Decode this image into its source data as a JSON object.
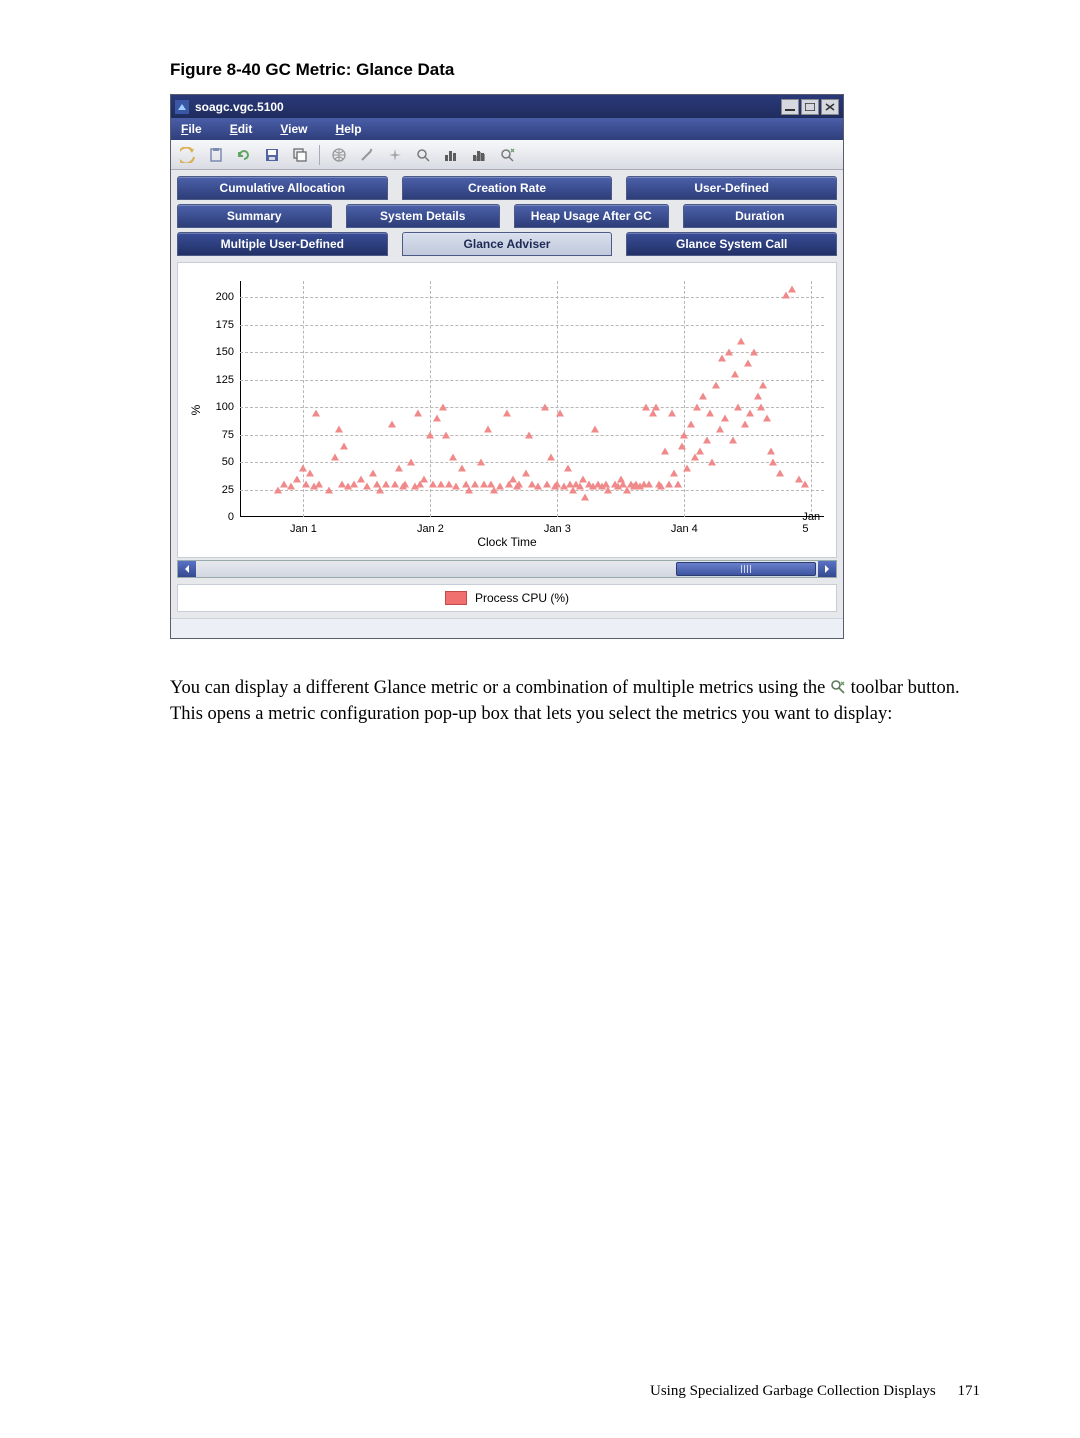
{
  "figure_caption": "Figure 8-40 GC Metric: Glance Data",
  "window": {
    "title": "soagc.vgc.5100",
    "menu": {
      "file": "File",
      "edit": "Edit",
      "view": "View",
      "help": "Help"
    },
    "toolbar_icons": [
      "back-arrow-icon",
      "clipboard-icon",
      "refresh-icon",
      "save-icon",
      "windows-icon",
      "globe-icon",
      "wand-icon",
      "sparkle-icon",
      "zoom-icon",
      "bars-icon",
      "bars-shadow-icon",
      "zoom-reset-icon"
    ],
    "win_btns": {
      "min": "minimize-icon",
      "max": "maximize-icon",
      "close": "close-icon"
    }
  },
  "tabs": {
    "row1": [
      "Cumulative Allocation",
      "Creation Rate",
      "User-Defined"
    ],
    "row2": [
      "Summary",
      "System Details",
      "Heap Usage After GC",
      "Duration"
    ],
    "row3": [
      "Multiple User-Defined",
      "Glance Adviser",
      "Glance System Call"
    ],
    "selected": "Glance Adviser"
  },
  "legend": {
    "series": "Process CPU (%)"
  },
  "body_text": {
    "p1a": "You can display a different Glance metric or a combination of multiple metrics using the ",
    "p1b": " toolbar button. This opens a metric configuration pop-up box that lets you select the metrics you want to display:"
  },
  "footer": {
    "section": "Using Specialized Garbage Collection Displays",
    "page": "171"
  },
  "chart_data": {
    "type": "scatter",
    "title": "",
    "xlabel": "Clock Time",
    "ylabel": "%",
    "ylim": [
      0,
      215
    ],
    "yticks": [
      0,
      25,
      50,
      75,
      100,
      125,
      150,
      175,
      200
    ],
    "xticks": [
      "Jan 1",
      "Jan 2",
      "Jan 3",
      "Jan 4",
      "Jan 5"
    ],
    "xrange": [
      0.5,
      5.1
    ],
    "series": [
      {
        "name": "Process CPU (%)",
        "color": "#f08a8a",
        "points": [
          [
            0.8,
            25
          ],
          [
            0.85,
            30
          ],
          [
            0.9,
            28
          ],
          [
            0.95,
            35
          ],
          [
            1.0,
            45
          ],
          [
            1.02,
            30
          ],
          [
            1.05,
            40
          ],
          [
            1.08,
            28
          ],
          [
            1.1,
            95
          ],
          [
            1.12,
            30
          ],
          [
            1.2,
            25
          ],
          [
            1.25,
            55
          ],
          [
            1.28,
            80
          ],
          [
            1.3,
            30
          ],
          [
            1.32,
            65
          ],
          [
            1.35,
            28
          ],
          [
            1.4,
            30
          ],
          [
            1.45,
            35
          ],
          [
            1.5,
            28
          ],
          [
            1.55,
            40
          ],
          [
            1.58,
            30
          ],
          [
            1.6,
            25
          ],
          [
            1.65,
            30
          ],
          [
            1.7,
            85
          ],
          [
            1.72,
            30
          ],
          [
            1.75,
            45
          ],
          [
            1.78,
            28
          ],
          [
            1.8,
            30
          ],
          [
            1.85,
            50
          ],
          [
            1.88,
            28
          ],
          [
            1.9,
            95
          ],
          [
            1.92,
            30
          ],
          [
            1.95,
            35
          ],
          [
            2.0,
            75
          ],
          [
            2.02,
            30
          ],
          [
            2.05,
            90
          ],
          [
            2.08,
            30
          ],
          [
            2.1,
            100
          ],
          [
            2.12,
            75
          ],
          [
            2.15,
            30
          ],
          [
            2.18,
            55
          ],
          [
            2.2,
            28
          ],
          [
            2.25,
            45
          ],
          [
            2.28,
            30
          ],
          [
            2.3,
            25
          ],
          [
            2.35,
            30
          ],
          [
            2.4,
            50
          ],
          [
            2.42,
            30
          ],
          [
            2.45,
            80
          ],
          [
            2.48,
            30
          ],
          [
            2.5,
            25
          ],
          [
            2.55,
            28
          ],
          [
            2.6,
            95
          ],
          [
            2.62,
            30
          ],
          [
            2.65,
            35
          ],
          [
            2.68,
            28
          ],
          [
            2.7,
            30
          ],
          [
            2.75,
            40
          ],
          [
            2.78,
            75
          ],
          [
            2.8,
            30
          ],
          [
            2.85,
            28
          ],
          [
            2.9,
            100
          ],
          [
            2.92,
            30
          ],
          [
            2.95,
            55
          ],
          [
            2.98,
            28
          ],
          [
            3.0,
            30
          ],
          [
            3.02,
            95
          ],
          [
            3.05,
            28
          ],
          [
            3.08,
            45
          ],
          [
            3.1,
            30
          ],
          [
            3.12,
            25
          ],
          [
            3.15,
            30
          ],
          [
            3.18,
            28
          ],
          [
            3.2,
            35
          ],
          [
            3.22,
            18
          ],
          [
            3.25,
            30
          ],
          [
            3.28,
            28
          ],
          [
            3.3,
            80
          ],
          [
            3.32,
            30
          ],
          [
            3.35,
            28
          ],
          [
            3.38,
            30
          ],
          [
            3.4,
            25
          ],
          [
            3.45,
            30
          ],
          [
            3.48,
            28
          ],
          [
            3.5,
            35
          ],
          [
            3.52,
            30
          ],
          [
            3.55,
            25
          ],
          [
            3.58,
            30
          ],
          [
            3.6,
            28
          ],
          [
            3.62,
            30
          ],
          [
            3.65,
            28
          ],
          [
            3.68,
            30
          ],
          [
            3.7,
            100
          ],
          [
            3.72,
            30
          ],
          [
            3.75,
            95
          ],
          [
            3.78,
            100
          ],
          [
            3.8,
            30
          ],
          [
            3.82,
            28
          ],
          [
            3.85,
            60
          ],
          [
            3.88,
            30
          ],
          [
            3.9,
            95
          ],
          [
            3.92,
            40
          ],
          [
            3.95,
            30
          ],
          [
            3.98,
            65
          ],
          [
            4.0,
            75
          ],
          [
            4.02,
            45
          ],
          [
            4.05,
            85
          ],
          [
            4.08,
            55
          ],
          [
            4.1,
            100
          ],
          [
            4.12,
            60
          ],
          [
            4.15,
            110
          ],
          [
            4.18,
            70
          ],
          [
            4.2,
            95
          ],
          [
            4.22,
            50
          ],
          [
            4.25,
            120
          ],
          [
            4.28,
            80
          ],
          [
            4.3,
            145
          ],
          [
            4.32,
            90
          ],
          [
            4.35,
            150
          ],
          [
            4.38,
            70
          ],
          [
            4.4,
            130
          ],
          [
            4.42,
            100
          ],
          [
            4.45,
            160
          ],
          [
            4.48,
            85
          ],
          [
            4.5,
            140
          ],
          [
            4.52,
            95
          ],
          [
            4.55,
            150
          ],
          [
            4.58,
            110
          ],
          [
            4.6,
            100
          ],
          [
            4.62,
            120
          ],
          [
            4.65,
            90
          ],
          [
            4.68,
            60
          ],
          [
            4.7,
            50
          ],
          [
            4.75,
            40
          ],
          [
            4.8,
            202
          ],
          [
            4.85,
            208
          ],
          [
            4.9,
            35
          ],
          [
            4.95,
            30
          ]
        ]
      }
    ]
  }
}
